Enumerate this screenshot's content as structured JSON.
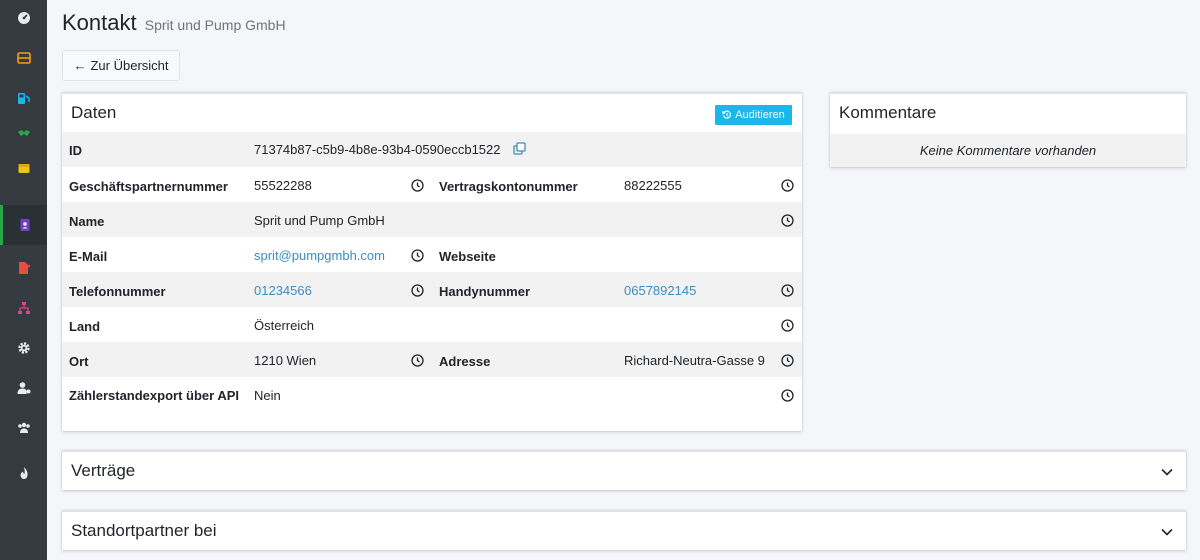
{
  "colors": {
    "sidebar_bg": "#343a40",
    "accent_cyan": "#1ab8e8",
    "link": "#3c8dbc",
    "active_border": "#28a745"
  },
  "sidebar": {
    "items": [
      {
        "icon": "dashboard-icon"
      },
      {
        "icon": "inbox-icon"
      },
      {
        "icon": "gas-pump-icon"
      },
      {
        "icon": "handshake-icon"
      },
      {
        "icon": "box-icon"
      },
      {
        "icon": "address-book-icon",
        "active": true
      },
      {
        "icon": "file-signature-icon"
      },
      {
        "icon": "sitemap-icon"
      },
      {
        "icon": "cog-icon"
      },
      {
        "icon": "user-cog-icon"
      },
      {
        "icon": "users-icon"
      },
      {
        "icon": "fire-icon"
      }
    ]
  },
  "header": {
    "title": "Kontakt",
    "subtitle": "Sprit und Pump GmbH"
  },
  "back_button": {
    "arrow": "←",
    "label": "Zur Übersicht"
  },
  "daten": {
    "title": "Daten",
    "audit_label": "Auditieren",
    "id_label": "ID",
    "id_value": "71374b87-c5b9-4b8e-93b4-0590eccb1522",
    "gp_label": "Geschäftspartnernummer",
    "gp_value": "55522288",
    "vk_label": "Vertragskontonummer",
    "vk_value": "88222555",
    "name_label": "Name",
    "name_value": "Sprit und Pump GmbH",
    "email_label": "E-Mail",
    "email_value": "sprit@pumpgmbh.com",
    "web_label": "Webseite",
    "tel_label": "Telefonnummer",
    "tel_value": "01234566",
    "handy_label": "Handynummer",
    "handy_value": "0657892145",
    "land_label": "Land",
    "land_value": "Österreich",
    "ort_label": "Ort",
    "ort_value": "1210 Wien",
    "adresse_label": "Adresse",
    "adresse_value": "Richard-Neutra-Gasse 9",
    "export_label": "Zählerstandexport über API",
    "export_value": "Nein"
  },
  "kommentare": {
    "title": "Kommentare",
    "empty": "Keine Kommentare vorhanden"
  },
  "sections": [
    {
      "title": "Verträge"
    },
    {
      "title": "Standortpartner bei"
    }
  ]
}
